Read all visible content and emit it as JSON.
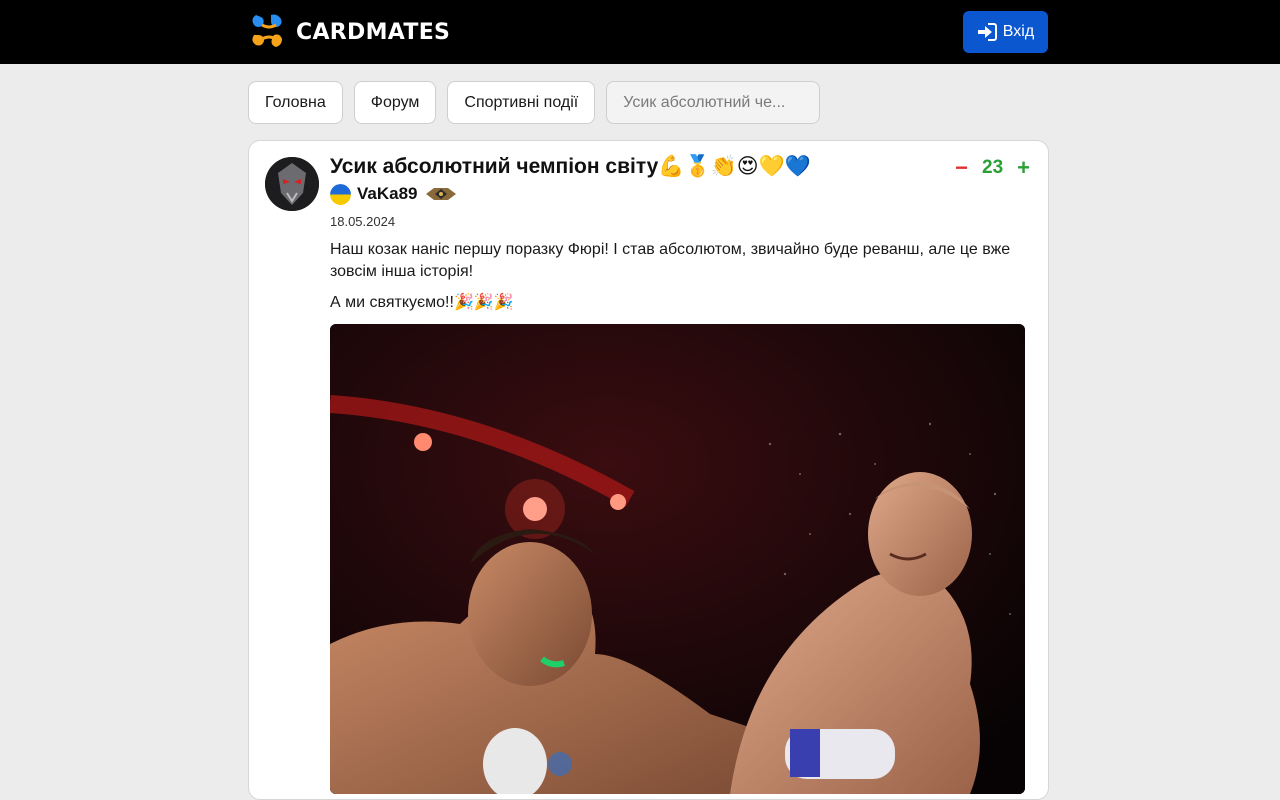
{
  "header": {
    "logo_text": "CARDMATES",
    "login_label": "Вхід"
  },
  "breadcrumbs": [
    {
      "label": "Головна"
    },
    {
      "label": "Форум"
    },
    {
      "label": "Спортивні події"
    },
    {
      "label": "Усик абсолютний че..."
    }
  ],
  "post": {
    "title": "Усик абсолютний чемпіон світу💪🥇👏😍💛💙",
    "author": "VaKa89",
    "date": "18.05.2024",
    "score": "23",
    "vote_down": "−",
    "vote_up": "+",
    "paragraph1": "Наш козак наніс першу поразку Фюрі! І став абсолютом, звичайно буде реванш, але це вже зовсім інша історія!",
    "paragraph2": "А ми святкуємо!!🎉🎉🎉"
  },
  "colors": {
    "login_button": "#0b57d0",
    "vote_down": "#e03030",
    "vote_up": "#2aa037"
  },
  "icons": {
    "login": "sign-in-icon",
    "flag": "ukraine-flag-icon",
    "rank": "rank-badge-icon"
  }
}
